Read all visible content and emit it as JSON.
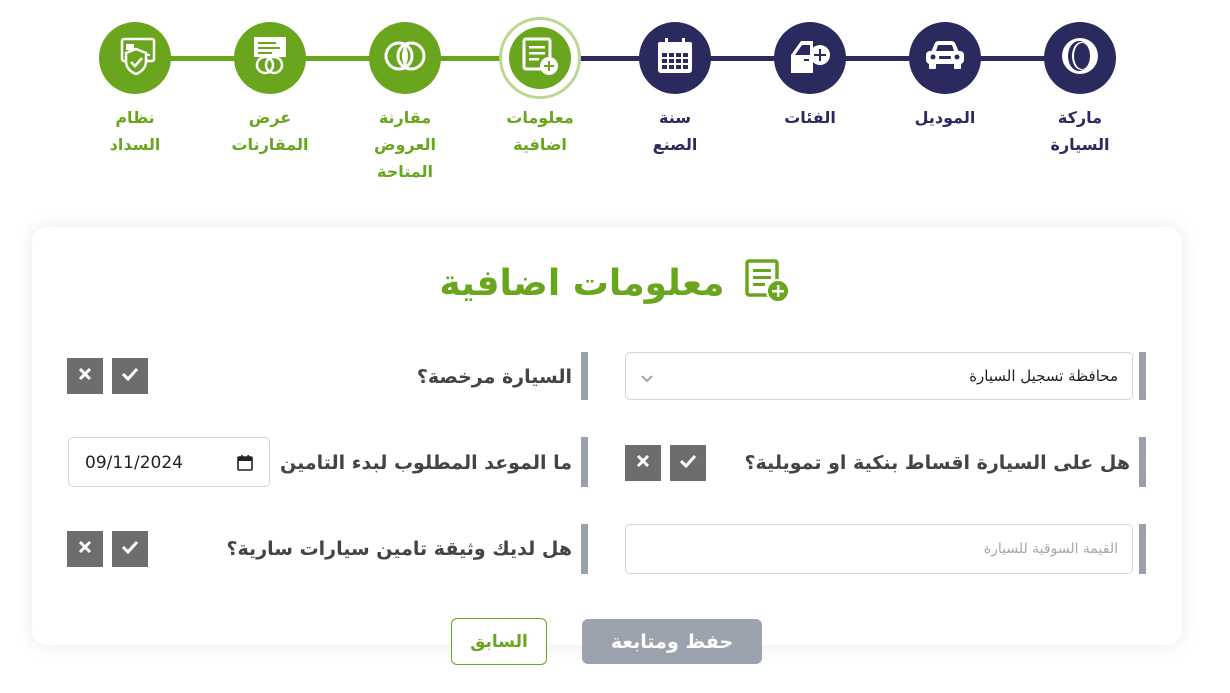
{
  "steps": [
    {
      "line1": "ماركة",
      "line2": "السيارة",
      "icon": "brand-logo-icon",
      "state": "done"
    },
    {
      "line1": "الموديل",
      "line2": "",
      "icon": "car-icon",
      "state": "done"
    },
    {
      "line1": "الفئات",
      "line2": "",
      "icon": "car-door-plus-icon",
      "state": "done"
    },
    {
      "line1": "سنة",
      "line2": "الصنع",
      "icon": "calendar-icon",
      "state": "done"
    },
    {
      "line1": "معلومات",
      "line2": "اضافية",
      "icon": "document-plus-icon",
      "state": "current"
    },
    {
      "line1": "مقارنة",
      "line2": "العروض المتاحة",
      "icon": "compare-offers-icon",
      "state": "upcoming"
    },
    {
      "line1": "عرض",
      "line2": "المقارنات",
      "icon": "comparison-view-icon",
      "state": "upcoming"
    },
    {
      "line1": "نظام",
      "line2": "السداد",
      "icon": "payment-card-shield-icon",
      "state": "upcoming"
    }
  ],
  "form": {
    "title": "معلومات اضافية",
    "governorate_select": "محافظة تسجيل السيارة",
    "licensed_question": "السيارة مرخصة؟",
    "installments_question": "هل على السيارة اقساط بنكية او تمويلية؟",
    "start_date_question": "ما الموعد المطلوب لبدء التامين",
    "start_date_value": "09/11/2024",
    "market_value_placeholder": "القيمة السوقية للسيارة",
    "existing_policy_question": "هل لديك وثيقة تامين سيارات سارية؟"
  },
  "buttons": {
    "save_continue": "حفظ ومتابعة",
    "previous": "السابق"
  },
  "colors": {
    "navy": "#2a2a5e",
    "green": "#6aa51e",
    "disabled": "#9ca3ae"
  }
}
